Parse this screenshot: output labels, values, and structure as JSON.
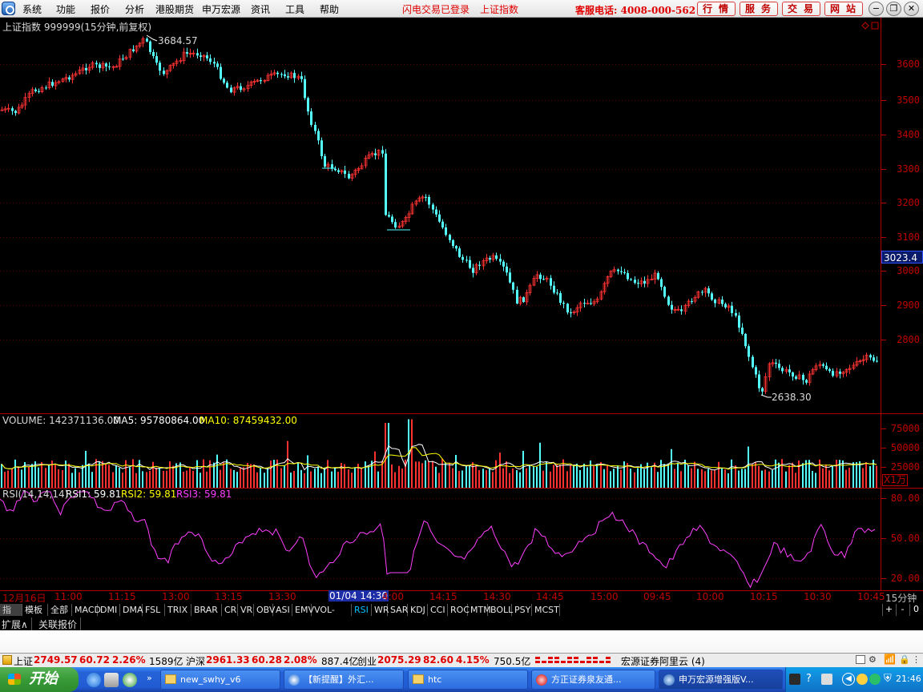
{
  "menubar": {
    "items": [
      "系统",
      "功能",
      "报价",
      "分析",
      "港股期货",
      "申万宏源",
      "资讯",
      "工具",
      "帮助"
    ],
    "flash_login": "闪电交易已登录",
    "current_index": "上证指数",
    "hotline": "客服电话: 4008-000-562",
    "buttons": [
      "行情",
      "服务",
      "交易",
      "网站"
    ]
  },
  "price_chart": {
    "title": "上证指数 999999(15分钟,前复权)",
    "high_label": "3684.57",
    "low_label": "2638.30",
    "current_price": "3023.4",
    "y_ticks": [
      "3600",
      "3500",
      "3400",
      "3300",
      "3200",
      "3100",
      "3000",
      "2900",
      "2800"
    ]
  },
  "volume_chart": {
    "label": "VOLUME: 142371136.00",
    "ma5_label": "MA5: 95780864.00",
    "ma10_label": "MA10: 87459432.00",
    "y_ticks": [
      "75000",
      "50000",
      "25000"
    ],
    "unit": "X1万"
  },
  "rsi_chart": {
    "label": "RSI(14,14,14)",
    "rsi1": "RSI1: 59.81",
    "rsi2": "RSI2: 59.81",
    "rsi3": "RSI3: 59.81",
    "y_ticks": [
      "80.00",
      "50.00",
      "20.00"
    ]
  },
  "time_axis": {
    "labels": [
      "12月16日",
      "11:00",
      "11:15",
      "13:00",
      "13:15",
      "13:30",
      "01/04 14:30",
      "4:00",
      "14:15",
      "14:30",
      "14:45",
      "15:00",
      "09:45",
      "10:00",
      "10:15",
      "10:30",
      "10:45"
    ],
    "period": "15分钟",
    "plus": "+",
    "minus": "-",
    "zero": "0"
  },
  "indicator_tabs": [
    "指标",
    "模板",
    "全部",
    "MACD",
    "DMI",
    "DMA",
    "FSL",
    "TRIX",
    "BRAR",
    "CR",
    "VR",
    "OBV",
    "ASI",
    "EMV",
    "VOL-TDX",
    "RSI",
    "WR",
    "SAR",
    "KDJ",
    "CCI",
    "ROC",
    "MTM",
    "BOLL",
    "PSY",
    "MCST"
  ],
  "secondary_tabs": [
    "扩展∧",
    "关联报价"
  ],
  "status": {
    "sh_name": "上证",
    "sh_value": "2749.57",
    "sh_change": "60.72",
    "sh_pct": "2.26%",
    "sh_amount": "1589亿",
    "hs_name": "沪深",
    "hs_value": "2961.33",
    "hs_change": "60.28",
    "hs_pct": "2.08%",
    "hs_amount": "887.4亿",
    "cy_name": "创业",
    "cy_value": "2075.29",
    "cy_change": "82.60",
    "cy_pct": "4.15%",
    "cy_amount": "750.5亿",
    "server": "宏源证券阿里云 (4)"
  },
  "taskbar": {
    "start": "开始",
    "items": [
      "new_swhy_v6",
      "【新提醒】外汇...",
      "htc",
      "方正证券泉友通...",
      "申万宏源增强版V..."
    ],
    "clock": "21:46"
  },
  "colors": {
    "up": "#ff3232",
    "down": "#54ffff",
    "axis": "#b00000",
    "ma5": "#ffffff",
    "ma10": "#ffff00",
    "rsi": "#ff40ff"
  }
}
